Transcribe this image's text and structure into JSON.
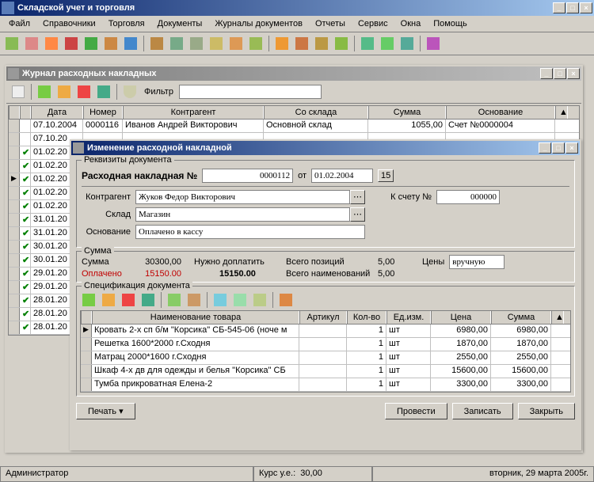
{
  "main": {
    "title": "Складской учет и торговля",
    "menus": [
      "Файл",
      "Справочники",
      "Торговля",
      "Документы",
      "Журналы документов",
      "Отчеты",
      "Сервис",
      "Окна",
      "Помощь"
    ]
  },
  "journal": {
    "title": "Журнал расходных накладных",
    "filter_label": "Фильтр",
    "filter_value": "",
    "columns": {
      "date": "Дата",
      "number": "Номер",
      "contragent": "Контрагент",
      "warehouse": "Со склада",
      "sum": "Сумма",
      "basis": "Основание"
    },
    "rows": [
      {
        "chk": "",
        "date": "07.10.2004",
        "number": "0000116",
        "contragent": "Иванов Андрей Викторович",
        "warehouse": "Основной склад",
        "sum": "1055,00",
        "basis": "Счет №0000004"
      },
      {
        "chk": "",
        "date": "07.10.20"
      },
      {
        "chk": "✔",
        "date": "01.02.20"
      },
      {
        "chk": "✔",
        "date": "01.02.20"
      },
      {
        "chk": "✔",
        "date": "01.02.20",
        "mark": "▶"
      },
      {
        "chk": "✔",
        "date": "01.02.20"
      },
      {
        "chk": "✔",
        "date": "01.02.20"
      },
      {
        "chk": "✔",
        "date": "31.01.20"
      },
      {
        "chk": "✔",
        "date": "31.01.20"
      },
      {
        "chk": "✔",
        "date": "30.01.20"
      },
      {
        "chk": "✔",
        "date": "30.01.20"
      },
      {
        "chk": "✔",
        "date": "29.01.20"
      },
      {
        "chk": "✔",
        "date": "29.01.20"
      },
      {
        "chk": "✔",
        "date": "28.01.20"
      },
      {
        "chk": "✔",
        "date": "28.01.20"
      },
      {
        "chk": "✔",
        "date": "28.01.20"
      }
    ]
  },
  "editwin": {
    "title": "Изменение расходной накладной",
    "requisites_label": "Реквизиты документа",
    "doc_label": "Расходная накладная №",
    "doc_number": "0000112",
    "from_label": "от",
    "doc_date": "01.02.2004",
    "contragent_label": "Контрагент",
    "contragent_value": "Жуков Федор Викторович",
    "account_label": "К счету №",
    "account_value": "000000",
    "warehouse_label": "Склад",
    "warehouse_value": "Магазин",
    "basis_label": "Основание",
    "basis_value": "Оплачено в кассу",
    "sum_group_label": "Сумма",
    "sum_label": "Сумма",
    "sum_value": "30300,00",
    "paid_label": "Оплачено",
    "paid_value": "15150.00",
    "topay_label": "Нужно доплатить",
    "topay_value": "15150.00",
    "positions_label": "Всего позиций",
    "positions_value": "5,00",
    "names_label": "Всего наименований",
    "names_value": "5,00",
    "prices_label": "Цены",
    "prices_value": "вручную",
    "spec_label": "Спецификация документа",
    "spec_columns": {
      "name": "Наименование товара",
      "article": "Артикул",
      "qty": "Кол-во",
      "unit": "Ед.изм.",
      "price": "Цена",
      "sum": "Сумма"
    },
    "spec_rows": [
      {
        "name": "Кровать 2-х сп б/м \"Корсика\" СБ-545-06 (ноче м",
        "article": "",
        "qty": "1",
        "unit": "шт",
        "price": "6980,00",
        "sum": "6980,00",
        "mark": "▶"
      },
      {
        "name": "Решетка 1600*2000 г.Сходня",
        "article": "",
        "qty": "1",
        "unit": "шт",
        "price": "1870,00",
        "sum": "1870,00"
      },
      {
        "name": "Матрац 2000*1600 г.Сходня",
        "article": "",
        "qty": "1",
        "unit": "шт",
        "price": "2550,00",
        "sum": "2550,00"
      },
      {
        "name": "Шкаф 4-х дв  для одежды и белья \"Корсика\" СБ",
        "article": "",
        "qty": "1",
        "unit": "шт",
        "price": "15600,00",
        "sum": "15600,00"
      },
      {
        "name": "Тумба прикроватная Елена-2",
        "article": "",
        "qty": "1",
        "unit": "шт",
        "price": "3300,00",
        "sum": "3300,00"
      }
    ],
    "buttons": {
      "print": "Печать",
      "post": "Провести",
      "save": "Записать",
      "close": "Закрыть"
    }
  },
  "status": {
    "user": "Администратор",
    "rate_label": "Курс у.е.:",
    "rate_value": "30,00",
    "date": "вторник, 29 марта 2005г."
  }
}
